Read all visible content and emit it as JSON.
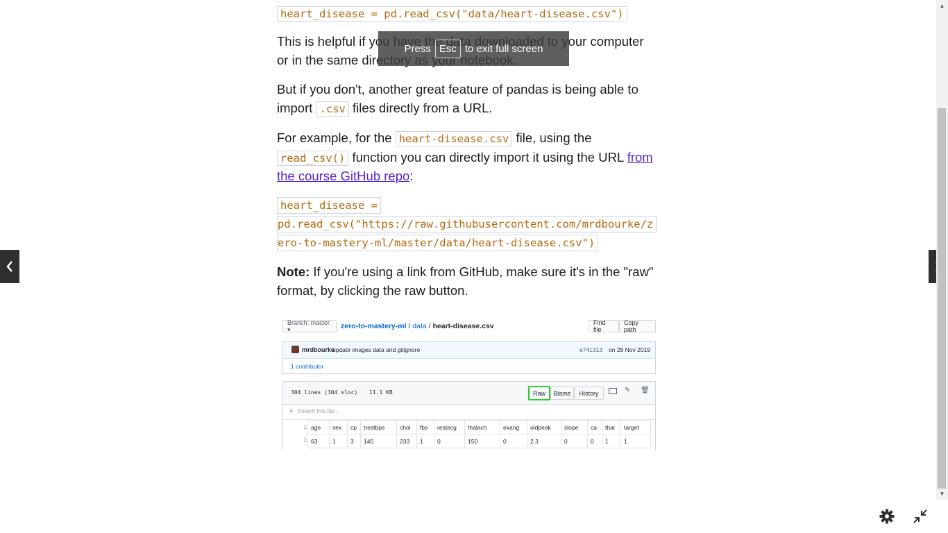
{
  "article": {
    "code_top": "heart_disease = pd.read_csv(\"data/heart-disease.csv\")",
    "p1": "This is helpful if you have the data downloaded to your computer or in the same directory as your notebook.",
    "p2_before": "But if you don't, another great feature of pandas is being able to import ",
    "p2_code": ".csv",
    "p2_after": " files directly from a URL.",
    "p3_before": "For example, for the ",
    "p3_code1": "heart-disease.csv",
    "p3_mid": " file, using the ",
    "p3_code2": "read_csv()",
    "p3_after": " function you can directly import it using the URL ",
    "p3_link": "from the course GitHub repo",
    "p3_end": ":",
    "code_url_line1": "heart_disease =",
    "code_url_line2": "pd.read_csv(\"https://raw.githubusercontent.com/mrdbourke/z",
    "code_url_line3": "ero-to-mastery-ml/master/data/heart-disease.csv\")",
    "note_label": "Note:",
    "note_text": " If you're using a link from GitHub, make sure it's in the \"raw\" format, by clicking the raw button."
  },
  "fullscreen_toast": {
    "press": "Press",
    "key": "Esc",
    "rest": "to exit full screen"
  },
  "github": {
    "branch": "Branch: master ▾",
    "repo": "zero-to-mastery-ml",
    "sep1": " / ",
    "folder": "data",
    "sep2": " / ",
    "file": "heart-disease.csv",
    "find_file": "Find file",
    "copy_path": "Copy path",
    "author": "mrdbourke",
    "commit_msg": "update images data and gitignore",
    "commit_hash": "e741313",
    "commit_date": "on 28 Nov 2019",
    "contributors": "1 contributor",
    "lines_info": "304 lines (304 sloc)",
    "size": "11.1 KB",
    "raw": "Raw",
    "blame": "Blame",
    "history": "History",
    "search_placeholder": "Search this file...",
    "headers": [
      "age",
      "sex",
      "cp",
      "trestbps",
      "chol",
      "fbs",
      "restecg",
      "thalach",
      "exang",
      "oldpeak",
      "slope",
      "ca",
      "thal",
      "target"
    ],
    "row": [
      "63",
      "1",
      "3",
      "145",
      "233",
      "1",
      "0",
      "150",
      "0",
      "2.3",
      "0",
      "0",
      "1",
      "1"
    ],
    "line_nums": [
      "1",
      "2"
    ],
    "raw_highlight_color": "#2dcc2d"
  },
  "colors": {
    "code": "#b4690e",
    "link": "#5624d0",
    "nav_bg": "#2d2f31"
  }
}
